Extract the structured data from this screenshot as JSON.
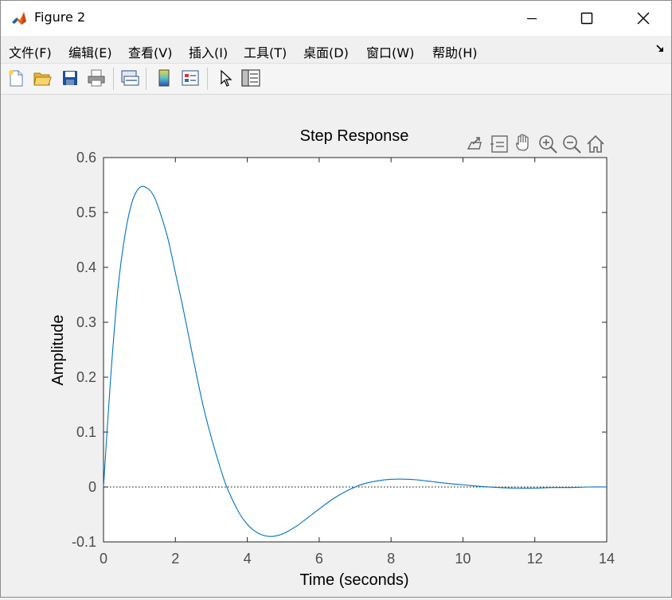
{
  "window": {
    "title": "Figure 2",
    "icon": "matlab-logo-icon"
  },
  "menubar": {
    "items": [
      {
        "label": "文件(F)"
      },
      {
        "label": "编辑(E)"
      },
      {
        "label": "查看(V)"
      },
      {
        "label": "插入(I)"
      },
      {
        "label": "工具(T)"
      },
      {
        "label": "桌面(D)"
      },
      {
        "label": "窗口(W)"
      },
      {
        "label": "帮助(H)"
      }
    ]
  },
  "toolbar": {
    "buttons": [
      "new-figure-icon",
      "open-folder-icon",
      "save-icon",
      "print-icon",
      "link-plot-icon",
      "colorbar-icon",
      "legend-icon",
      "edit-plot-pointer-icon",
      "property-inspector-icon"
    ]
  },
  "axes_toolbar": {
    "buttons": [
      "export-icon",
      "brush-icon",
      "pan-hand-icon",
      "zoom-in-icon",
      "zoom-out-icon",
      "home-icon"
    ]
  },
  "colors": {
    "line": "#0072bd",
    "axis": "#262626",
    "tick_label": "#4d4d4d",
    "background": "#f0f0f0"
  },
  "chart_data": {
    "type": "line",
    "title": "Step Response",
    "xlabel": "Time (seconds)",
    "ylabel": "Amplitude",
    "xlim": [
      0,
      14
    ],
    "ylim": [
      -0.1,
      0.6
    ],
    "xticks": [
      "0",
      "2",
      "4",
      "6",
      "8",
      "10",
      "12",
      "14"
    ],
    "yticks": [
      "-0.1",
      "0",
      "0.1",
      "0.2",
      "0.3",
      "0.4",
      "0.5",
      "0.6"
    ],
    "reference_line": {
      "y": 0,
      "style": "dotted"
    },
    "grid": false,
    "series": [
      {
        "x": [
          0,
          0.2,
          0.4,
          0.6,
          0.8,
          1.0,
          1.2,
          1.4,
          1.6,
          1.8,
          2.0,
          2.2,
          2.4,
          2.6,
          2.8,
          3.0,
          3.2,
          3.4,
          3.6,
          3.8,
          4.0,
          4.2,
          4.4,
          4.6,
          4.8,
          5.0,
          5.2,
          5.4,
          5.6,
          5.8,
          6.0,
          6.4,
          6.8,
          7.2,
          7.6,
          8.0,
          8.5,
          9.0,
          9.5,
          10.0,
          10.5,
          11.0,
          11.5,
          12.0,
          12.5,
          13.0,
          13.5,
          14.0
        ],
        "y": [
          0,
          0.2,
          0.36,
          0.46,
          0.52,
          0.545,
          0.545,
          0.53,
          0.495,
          0.45,
          0.39,
          0.33,
          0.265,
          0.2,
          0.14,
          0.09,
          0.045,
          0.005,
          -0.025,
          -0.05,
          -0.068,
          -0.08,
          -0.087,
          -0.09,
          -0.089,
          -0.085,
          -0.078,
          -0.07,
          -0.06,
          -0.05,
          -0.04,
          -0.021,
          -0.006,
          0.005,
          0.011,
          0.014,
          0.014,
          0.011,
          0.007,
          0.004,
          0.001,
          -0.001,
          -0.002,
          -0.002,
          -0.001,
          -0.001,
          0.0,
          0.0
        ]
      }
    ]
  }
}
